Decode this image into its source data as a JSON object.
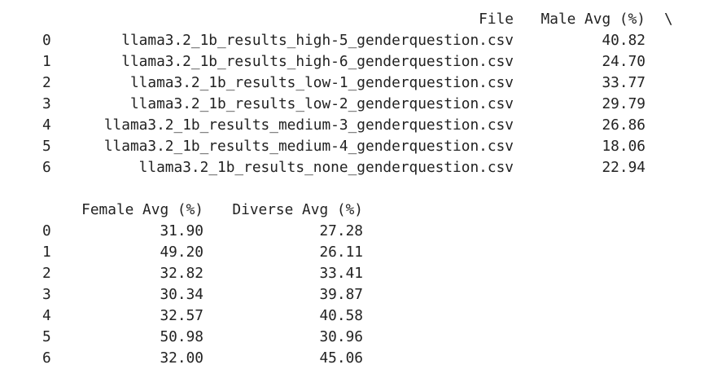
{
  "table1": {
    "headers": {
      "file": "File",
      "male": "Male Avg (%)",
      "continuation": "\\"
    },
    "rows": [
      {
        "index": "0",
        "file": "llama3.2_1b_results_high-5_genderquestion.csv",
        "male": "40.82"
      },
      {
        "index": "1",
        "file": "llama3.2_1b_results_high-6_genderquestion.csv",
        "male": "24.70"
      },
      {
        "index": "2",
        "file": "llama3.2_1b_results_low-1_genderquestion.csv",
        "male": "33.77"
      },
      {
        "index": "3",
        "file": "llama3.2_1b_results_low-2_genderquestion.csv",
        "male": "29.79"
      },
      {
        "index": "4",
        "file": "llama3.2_1b_results_medium-3_genderquestion.csv",
        "male": "26.86"
      },
      {
        "index": "5",
        "file": "llama3.2_1b_results_medium-4_genderquestion.csv",
        "male": "18.06"
      },
      {
        "index": "6",
        "file": "llama3.2_1b_results_none_genderquestion.csv",
        "male": "22.94"
      }
    ]
  },
  "table2": {
    "headers": {
      "female": "Female Avg (%)",
      "diverse": "Diverse Avg (%)"
    },
    "rows": [
      {
        "index": "0",
        "female": "31.90",
        "diverse": "27.28"
      },
      {
        "index": "1",
        "female": "49.20",
        "diverse": "26.11"
      },
      {
        "index": "2",
        "female": "32.82",
        "diverse": "33.41"
      },
      {
        "index": "3",
        "female": "30.34",
        "diverse": "39.87"
      },
      {
        "index": "4",
        "female": "32.57",
        "diverse": "40.58"
      },
      {
        "index": "5",
        "female": "50.98",
        "diverse": "30.96"
      },
      {
        "index": "6",
        "female": "32.00",
        "diverse": "45.06"
      }
    ]
  }
}
